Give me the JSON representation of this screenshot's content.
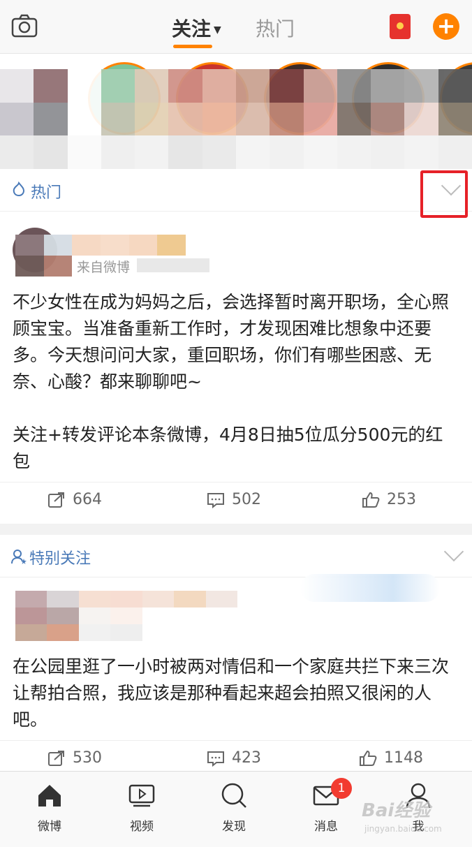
{
  "header": {
    "tabs": [
      {
        "label": "关注",
        "active": true
      },
      {
        "label": "热门",
        "active": false
      }
    ],
    "icons": [
      "camera-icon",
      "red-packet-icon",
      "plus-icon"
    ]
  },
  "sections": [
    {
      "label": "热门",
      "post": {
        "source": "来自微博",
        "text": "不少女性在成为妈妈之后，会选择暂时离开职场，全心照顾宝宝。当准备重新工作时，才发现困难比想象中还要多。今天想问问大家，重回职场，你们有哪些困惑、无奈、心酸？都来聊聊吧~",
        "text2": "关注+转发评论本条微博，4月8日抽5位瓜分500元的红包",
        "reposts": "664",
        "comments": "502",
        "likes": "253"
      }
    },
    {
      "label": "特别关注",
      "post": {
        "text": "在公园里逛了一小时被两对情侣和一个家庭共拦下来三次让帮拍合照，我应该是那种看起来超会拍照又很闲的人吧。",
        "reposts": "530",
        "comments": "423",
        "likes": "1148"
      }
    }
  ],
  "bottom_nav": [
    {
      "label": "微博",
      "icon": "home-icon"
    },
    {
      "label": "视频",
      "icon": "video-icon"
    },
    {
      "label": "发现",
      "icon": "search-icon"
    },
    {
      "label": "消息",
      "icon": "mail-icon",
      "badge": "1"
    },
    {
      "label": "我",
      "icon": "profile-icon"
    }
  ],
  "watermark": {
    "text": "Bai经验",
    "sub": "jingyan.baidu.com"
  },
  "colors": {
    "accent": "#ff8200",
    "link": "#4a7ab8",
    "highlight_box": "#e62128",
    "badge": "#f23b30"
  }
}
